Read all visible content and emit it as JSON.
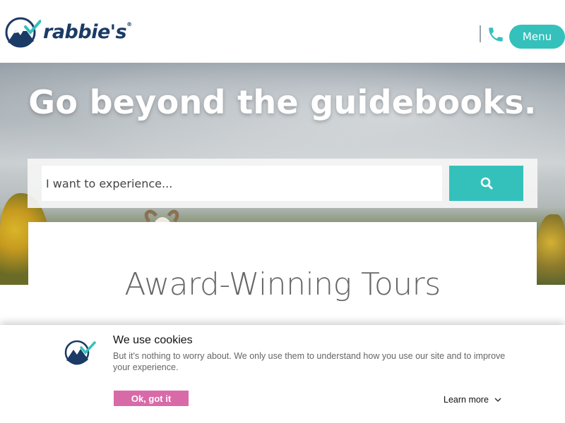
{
  "header": {
    "logo_text": "rabbie's",
    "logo_mark": "®",
    "phone_icon": "phone-icon",
    "menu_label": "Menu"
  },
  "hero": {
    "title": "Go beyond the guidebooks.",
    "search": {
      "placeholder": "I want to experience...",
      "button_icon": "search-icon"
    }
  },
  "main": {
    "section_title": "Award-Winning Tours"
  },
  "cookie_banner": {
    "title": "We use cookies",
    "text": "But it's nothing to worry about. We only use them to understand how you use our site and to improve your experience.",
    "ok_label": "Ok, got it",
    "learn_more_label": "Learn more"
  },
  "colors": {
    "accent": "#35c1bb",
    "brand_navy": "#1b3a66",
    "cookie_button": "#d96aa8"
  }
}
